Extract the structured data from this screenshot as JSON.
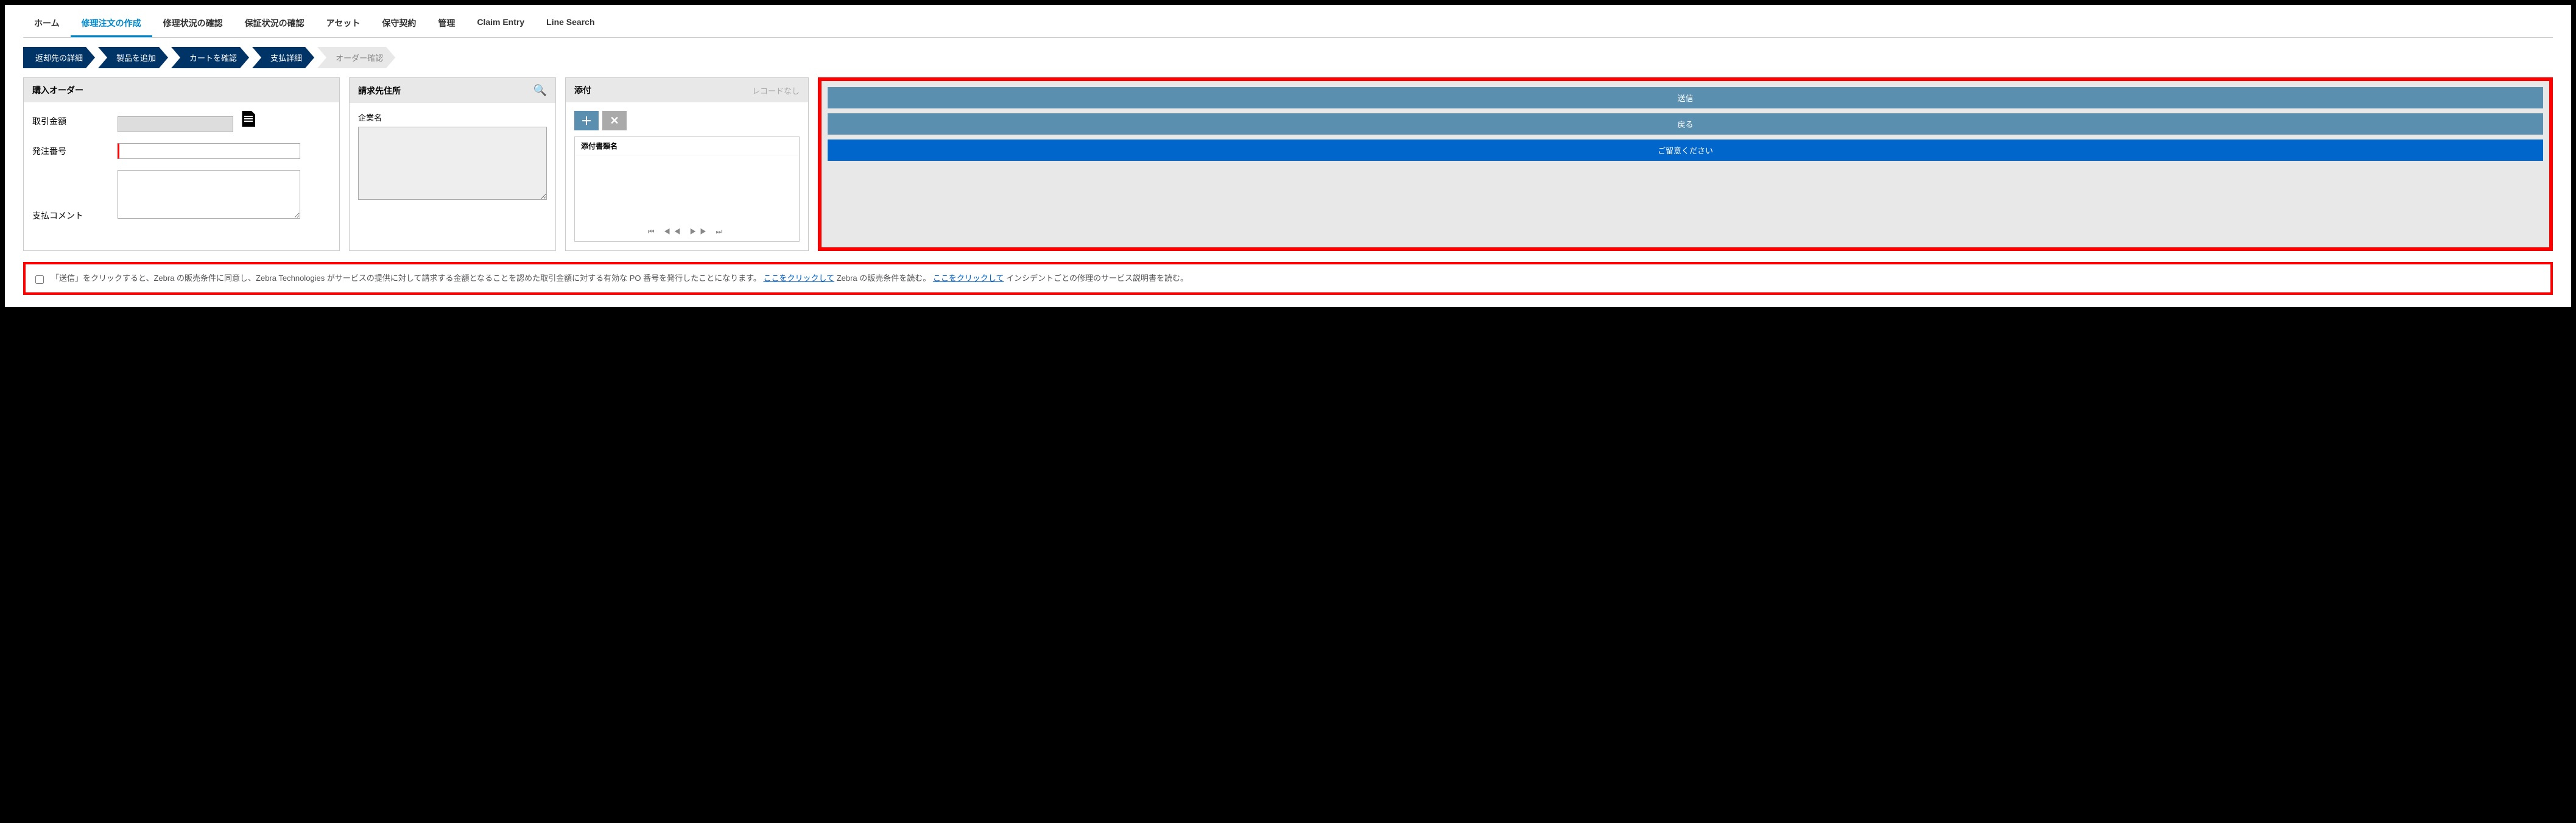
{
  "tabs": {
    "home": "ホーム",
    "create": "修理注文の作成",
    "repair_status": "修理状況の確認",
    "warranty_status": "保証状況の確認",
    "assets": "アセット",
    "contract": "保守契約",
    "manage": "管理",
    "claim": "Claim Entry",
    "line": "Line Search"
  },
  "steps": {
    "return": "返却先の詳細",
    "add_product": "製品を追加",
    "cart": "カートを確認",
    "payment": "支払詳細",
    "confirm": "オーダー確認"
  },
  "po": {
    "title": "購入オーダー",
    "amount_label": "取引金額",
    "amount_value": "",
    "number_label": "発注番号",
    "number_value": "",
    "comment_label": "支払コメント",
    "comment_value": ""
  },
  "billing": {
    "title": "請求先住所",
    "company_label": "企業名",
    "company_value": ""
  },
  "attach": {
    "title": "添付",
    "no_records": "レコードなし",
    "col_name": "添付書類名"
  },
  "actions": {
    "send": "送信",
    "back": "戻る",
    "note": "ご留意ください"
  },
  "consent": {
    "part1": "「送信」をクリックすると、Zebra の販売条件に同意し、Zebra Technologies がサービスの提供に対して請求する金額となることを認めた取引金額に対する有効な PO 番号を発行したことになります。",
    "link1": "ここをクリックして",
    "part2": " Zebra の販売条件を読む。 ",
    "link2": "ここをクリックして",
    "part3": " インシデントごとの修理のサービス説明書を読む。"
  }
}
